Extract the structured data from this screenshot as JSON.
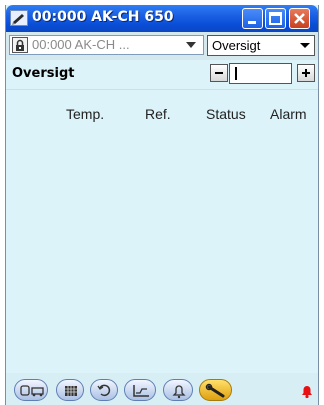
{
  "window": {
    "title": "00:000 AK-CH 650",
    "app_icon": "pencil-app-icon"
  },
  "toolbar": {
    "controller_value": "00:000 AK-CH ...",
    "view_value": "Oversigt"
  },
  "header": {
    "title": "Oversigt"
  },
  "table": {
    "columns": [
      "Temp.",
      "Ref.",
      "Status",
      "Alarm"
    ]
  },
  "bottom_nav": {
    "items": [
      {
        "icon": "refrigeration-icon"
      },
      {
        "icon": "grid-icon"
      },
      {
        "icon": "defrost-icon"
      },
      {
        "icon": "trend-chart-icon"
      },
      {
        "icon": "bell-icon"
      },
      {
        "icon": "wrench-icon",
        "active": true
      }
    ],
    "alarm_indicator": "red-bell-icon"
  },
  "colors": {
    "titlebar": "#0a4fd8",
    "content_bg": "#dcf3f9",
    "alarm_red": "#e81010"
  }
}
